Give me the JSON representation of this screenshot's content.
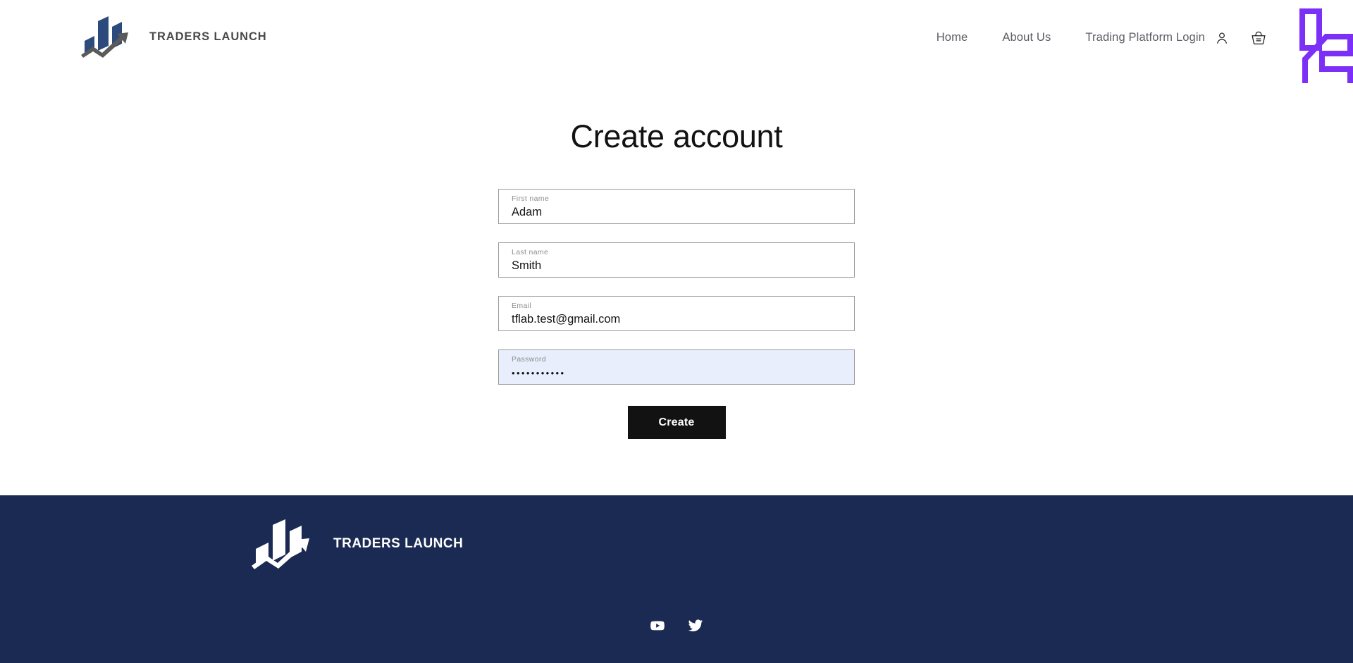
{
  "header": {
    "brand": {
      "name": "TRADERS LAUNCH",
      "logo_icon": "traders-launch-bars-arrow-logo",
      "bar_color": "#2c4a7c",
      "arrow_color": "#5a5a5a"
    },
    "nav": [
      {
        "label": "Home",
        "name": "home"
      },
      {
        "label": "About Us",
        "name": "about-us"
      },
      {
        "label": "Trading Platform Login",
        "name": "trading-platform-login"
      }
    ],
    "icons": [
      {
        "name": "account-icon",
        "glyph": "person"
      },
      {
        "name": "cart-icon",
        "glyph": "shopping-basket"
      }
    ],
    "corner_logo": {
      "name": "purple-overlay-logo",
      "color": "#7b2ff7"
    }
  },
  "main": {
    "title": "Create account",
    "fields": [
      {
        "name": "first-name",
        "label": "First name",
        "value": "Adam",
        "masked": false,
        "autofilled": false
      },
      {
        "name": "last-name",
        "label": "Last name",
        "value": "Smith",
        "masked": false,
        "autofilled": false
      },
      {
        "name": "email",
        "label": "Email",
        "value": "tflab.test@gmail.com",
        "masked": false,
        "autofilled": false
      },
      {
        "name": "password",
        "label": "Password",
        "value": "•••••••••••",
        "masked": true,
        "autofilled": true
      }
    ],
    "submit_label": "Create"
  },
  "footer": {
    "background": "#1b2a52",
    "brand": {
      "name": "TRADERS LAUNCH",
      "logo_icon": "traders-launch-bars-arrow-logo-white"
    },
    "social": [
      {
        "name": "youtube-icon",
        "label": "YouTube"
      },
      {
        "name": "twitter-icon",
        "label": "Twitter"
      }
    ]
  }
}
